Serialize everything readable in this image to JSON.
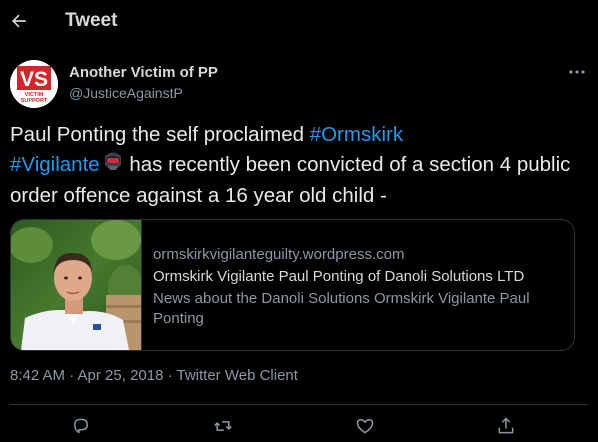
{
  "header": {
    "title": "Tweet",
    "back_icon": "arrow-left-icon"
  },
  "author": {
    "display_name": "Another Victim of PP",
    "handle": "@JusticeAgainstP",
    "avatar_text": "VS",
    "avatar_subtext_1": "VICTIM",
    "avatar_subtext_2": "SUPPORT"
  },
  "tweet": {
    "text_1": "Paul Ponting the self proclaimed ",
    "hashtag_1": "#Ormskirk",
    "hashtag_2": "#Vigilante",
    "text_2": " has recently been convicted of a section 4 public order offence against a 16 year old child -"
  },
  "card": {
    "domain": "ormskirkvigilanteguilty.wordpress.com",
    "title": "Ormskirk Vigilante Paul Ponting of Danoli Solutions LTD",
    "description": "News about the Danoli Solutions Ormskirk Vigilante Paul Ponting"
  },
  "meta": {
    "timestamp": "8:42 AM · Apr 25, 2018 · Twitter Web Client"
  },
  "colors": {
    "background": "#000000",
    "accent": "#1d9bf0",
    "secondary_text": "#8b98a5",
    "border": "#2f3336"
  },
  "actions": [
    "reply-icon",
    "retweet-icon",
    "like-icon",
    "share-icon"
  ]
}
